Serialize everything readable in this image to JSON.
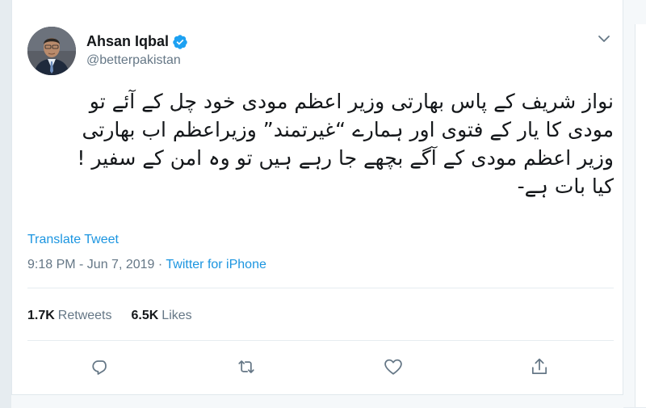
{
  "author": {
    "name": "Ahsan Iqbal",
    "handle": "@betterpakistan",
    "verified": true
  },
  "tweet": {
    "lines": [
      "نواز شریف کے پاس بھارتی وزیر اعظم مودی خود چل کے آئے تو",
      "مودی کا یار کے فتوی اور ہمارے “غیرتمند” وزیراعظم اب بھارتی",
      "وزیر اعظم مودی کے آگے بچھے جا رہے ہیں تو وہ امن کے سفیر !",
      "کیا بات ہے-"
    ],
    "translate_label": "Translate Tweet",
    "timestamp": "9:18 PM - Jun 7, 2019",
    "separator": " · ",
    "source": "Twitter for iPhone"
  },
  "stats": {
    "retweets_count": "1.7K",
    "retweets_label": "Retweets",
    "likes_count": "6.5K",
    "likes_label": "Likes"
  },
  "icons": {
    "reply": "reply-icon",
    "retweet": "retweet-icon",
    "like": "heart-icon",
    "share": "share-icon",
    "menu": "chevron-down-icon",
    "verified": "verified-badge-icon"
  },
  "colors": {
    "link": "#1b95e0",
    "secondary_text": "#657786",
    "primary_text": "#14171a",
    "verified": "#1da1f2"
  }
}
